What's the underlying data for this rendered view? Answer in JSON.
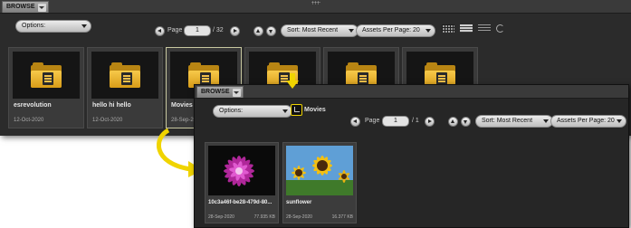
{
  "panel1": {
    "tab_label": "BROWSE",
    "options_label": "Options:",
    "page_label": "Page",
    "page_value": "1",
    "page_total": "/ 32",
    "sort_label": "Sort: Most Recent",
    "assets_label": "Assets Per Page: 20",
    "tiles": [
      {
        "name": "esrevolution",
        "date": "12-Oct-2020"
      },
      {
        "name": "hello hi hello",
        "date": "12-Oct-2020"
      },
      {
        "name": "Movies",
        "date": "28-Sep-2020"
      },
      {
        "name": "",
        "date": ""
      },
      {
        "name": "",
        "date": ""
      },
      {
        "name": "",
        "date": ""
      }
    ]
  },
  "panel2": {
    "tab_label": "BROWSE",
    "options_label": "Options:",
    "breadcrumb_label": "Movies",
    "page_label": "Page",
    "page_value": "1",
    "page_total": "/ 1",
    "sort_label": "Sort: Most Recent",
    "assets_label": "Assets Per Page: 20",
    "tiles": [
      {
        "name": "10c3a46f-be28-479d-80...",
        "date": "28-Sep-2020",
        "size": "77.935 KB"
      },
      {
        "name": "sunflower",
        "date": "28-Sep-2020",
        "size": "16.377 KB"
      }
    ]
  },
  "colors": {
    "highlight_yellow": "#f0d400",
    "panel_bg": "#2b2b2b",
    "folder_gold": "#e0a820"
  },
  "icons": [
    "chevron-down-icon",
    "prev-page-icon",
    "next-page-icon",
    "arrow-up-icon",
    "arrow-down-icon",
    "grid-view-icon",
    "list-view-icon",
    "detail-view-icon",
    "refresh-icon",
    "folder-icon",
    "parent-folder-icon"
  ]
}
